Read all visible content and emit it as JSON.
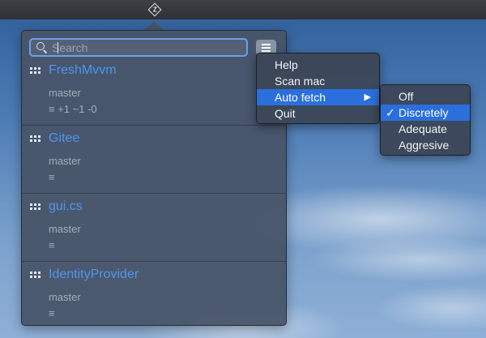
{
  "search": {
    "placeholder": "Search",
    "value": ""
  },
  "repos": [
    {
      "name": "FreshMvvm",
      "branch": "master",
      "status": "≡ +1 ~1 -0"
    },
    {
      "name": "Gitee",
      "branch": "master",
      "status": "≡"
    },
    {
      "name": "gui.cs",
      "branch": "master",
      "status": "≡"
    },
    {
      "name": "IdentityProvider",
      "branch": "master",
      "status": "≡"
    }
  ],
  "menu": {
    "items": [
      "Help",
      "Scan mac",
      "Auto fetch",
      "Quit"
    ],
    "submenu_arrow": "▶"
  },
  "submenu": {
    "items": [
      "Off",
      "Discretely",
      "Adequate",
      "Aggresive"
    ],
    "checked": "Discretely",
    "check_glyph": "✓"
  },
  "tray": {
    "icon_letter": "Z"
  }
}
